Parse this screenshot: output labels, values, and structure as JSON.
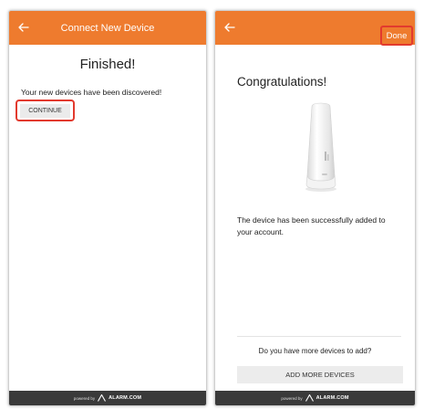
{
  "colors": {
    "accent": "#ee7b2e",
    "highlight": "#e23a2e",
    "footer_bg": "#3a3a3a"
  },
  "left_screen": {
    "header": {
      "back_icon": "arrow-left-icon",
      "title": "Connect New Device"
    },
    "heading": "Finished!",
    "message": "Your new devices have been discovered!",
    "continue_label": "CONTINUE",
    "footer": {
      "powered_by": "powered by",
      "brand": "ALARM.COM"
    }
  },
  "right_screen": {
    "header": {
      "back_icon": "arrow-left-icon",
      "done_label": "Done"
    },
    "heading": "Congratulations!",
    "device_image": "sensor-device-image",
    "message": "The device has been successfully added to your account.",
    "more_question": "Do you have more devices to add?",
    "add_more_label": "ADD MORE DEVICES",
    "footer": {
      "powered_by": "powered by",
      "brand": "ALARM.COM"
    }
  }
}
